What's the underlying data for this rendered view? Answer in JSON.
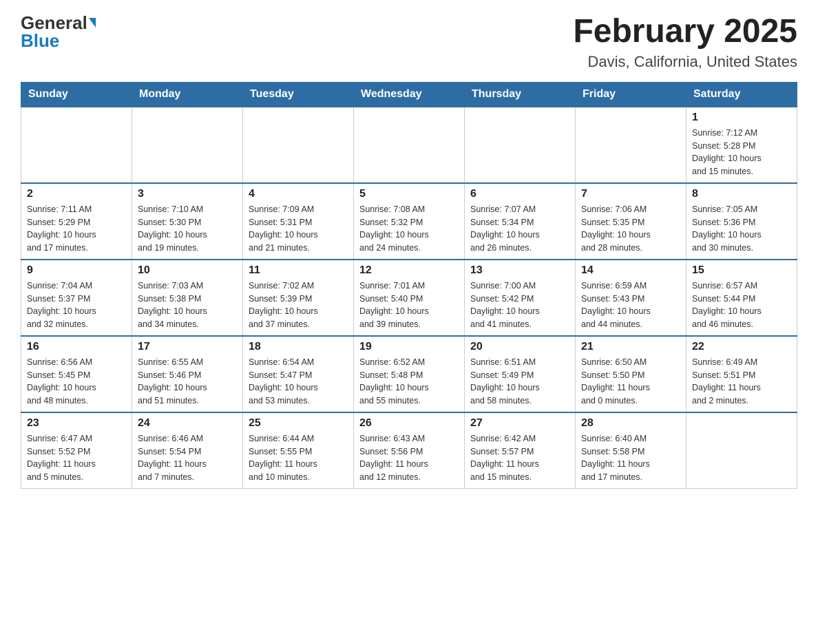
{
  "header": {
    "logo_general": "General",
    "logo_blue": "Blue",
    "month_title": "February 2025",
    "location": "Davis, California, United States"
  },
  "weekdays": [
    "Sunday",
    "Monday",
    "Tuesday",
    "Wednesday",
    "Thursday",
    "Friday",
    "Saturday"
  ],
  "weeks": [
    [
      {
        "day": "",
        "info": ""
      },
      {
        "day": "",
        "info": ""
      },
      {
        "day": "",
        "info": ""
      },
      {
        "day": "",
        "info": ""
      },
      {
        "day": "",
        "info": ""
      },
      {
        "day": "",
        "info": ""
      },
      {
        "day": "1",
        "info": "Sunrise: 7:12 AM\nSunset: 5:28 PM\nDaylight: 10 hours\nand 15 minutes."
      }
    ],
    [
      {
        "day": "2",
        "info": "Sunrise: 7:11 AM\nSunset: 5:29 PM\nDaylight: 10 hours\nand 17 minutes."
      },
      {
        "day": "3",
        "info": "Sunrise: 7:10 AM\nSunset: 5:30 PM\nDaylight: 10 hours\nand 19 minutes."
      },
      {
        "day": "4",
        "info": "Sunrise: 7:09 AM\nSunset: 5:31 PM\nDaylight: 10 hours\nand 21 minutes."
      },
      {
        "day": "5",
        "info": "Sunrise: 7:08 AM\nSunset: 5:32 PM\nDaylight: 10 hours\nand 24 minutes."
      },
      {
        "day": "6",
        "info": "Sunrise: 7:07 AM\nSunset: 5:34 PM\nDaylight: 10 hours\nand 26 minutes."
      },
      {
        "day": "7",
        "info": "Sunrise: 7:06 AM\nSunset: 5:35 PM\nDaylight: 10 hours\nand 28 minutes."
      },
      {
        "day": "8",
        "info": "Sunrise: 7:05 AM\nSunset: 5:36 PM\nDaylight: 10 hours\nand 30 minutes."
      }
    ],
    [
      {
        "day": "9",
        "info": "Sunrise: 7:04 AM\nSunset: 5:37 PM\nDaylight: 10 hours\nand 32 minutes."
      },
      {
        "day": "10",
        "info": "Sunrise: 7:03 AM\nSunset: 5:38 PM\nDaylight: 10 hours\nand 34 minutes."
      },
      {
        "day": "11",
        "info": "Sunrise: 7:02 AM\nSunset: 5:39 PM\nDaylight: 10 hours\nand 37 minutes."
      },
      {
        "day": "12",
        "info": "Sunrise: 7:01 AM\nSunset: 5:40 PM\nDaylight: 10 hours\nand 39 minutes."
      },
      {
        "day": "13",
        "info": "Sunrise: 7:00 AM\nSunset: 5:42 PM\nDaylight: 10 hours\nand 41 minutes."
      },
      {
        "day": "14",
        "info": "Sunrise: 6:59 AM\nSunset: 5:43 PM\nDaylight: 10 hours\nand 44 minutes."
      },
      {
        "day": "15",
        "info": "Sunrise: 6:57 AM\nSunset: 5:44 PM\nDaylight: 10 hours\nand 46 minutes."
      }
    ],
    [
      {
        "day": "16",
        "info": "Sunrise: 6:56 AM\nSunset: 5:45 PM\nDaylight: 10 hours\nand 48 minutes."
      },
      {
        "day": "17",
        "info": "Sunrise: 6:55 AM\nSunset: 5:46 PM\nDaylight: 10 hours\nand 51 minutes."
      },
      {
        "day": "18",
        "info": "Sunrise: 6:54 AM\nSunset: 5:47 PM\nDaylight: 10 hours\nand 53 minutes."
      },
      {
        "day": "19",
        "info": "Sunrise: 6:52 AM\nSunset: 5:48 PM\nDaylight: 10 hours\nand 55 minutes."
      },
      {
        "day": "20",
        "info": "Sunrise: 6:51 AM\nSunset: 5:49 PM\nDaylight: 10 hours\nand 58 minutes."
      },
      {
        "day": "21",
        "info": "Sunrise: 6:50 AM\nSunset: 5:50 PM\nDaylight: 11 hours\nand 0 minutes."
      },
      {
        "day": "22",
        "info": "Sunrise: 6:49 AM\nSunset: 5:51 PM\nDaylight: 11 hours\nand 2 minutes."
      }
    ],
    [
      {
        "day": "23",
        "info": "Sunrise: 6:47 AM\nSunset: 5:52 PM\nDaylight: 11 hours\nand 5 minutes."
      },
      {
        "day": "24",
        "info": "Sunrise: 6:46 AM\nSunset: 5:54 PM\nDaylight: 11 hours\nand 7 minutes."
      },
      {
        "day": "25",
        "info": "Sunrise: 6:44 AM\nSunset: 5:55 PM\nDaylight: 11 hours\nand 10 minutes."
      },
      {
        "day": "26",
        "info": "Sunrise: 6:43 AM\nSunset: 5:56 PM\nDaylight: 11 hours\nand 12 minutes."
      },
      {
        "day": "27",
        "info": "Sunrise: 6:42 AM\nSunset: 5:57 PM\nDaylight: 11 hours\nand 15 minutes."
      },
      {
        "day": "28",
        "info": "Sunrise: 6:40 AM\nSunset: 5:58 PM\nDaylight: 11 hours\nand 17 minutes."
      },
      {
        "day": "",
        "info": ""
      }
    ]
  ]
}
